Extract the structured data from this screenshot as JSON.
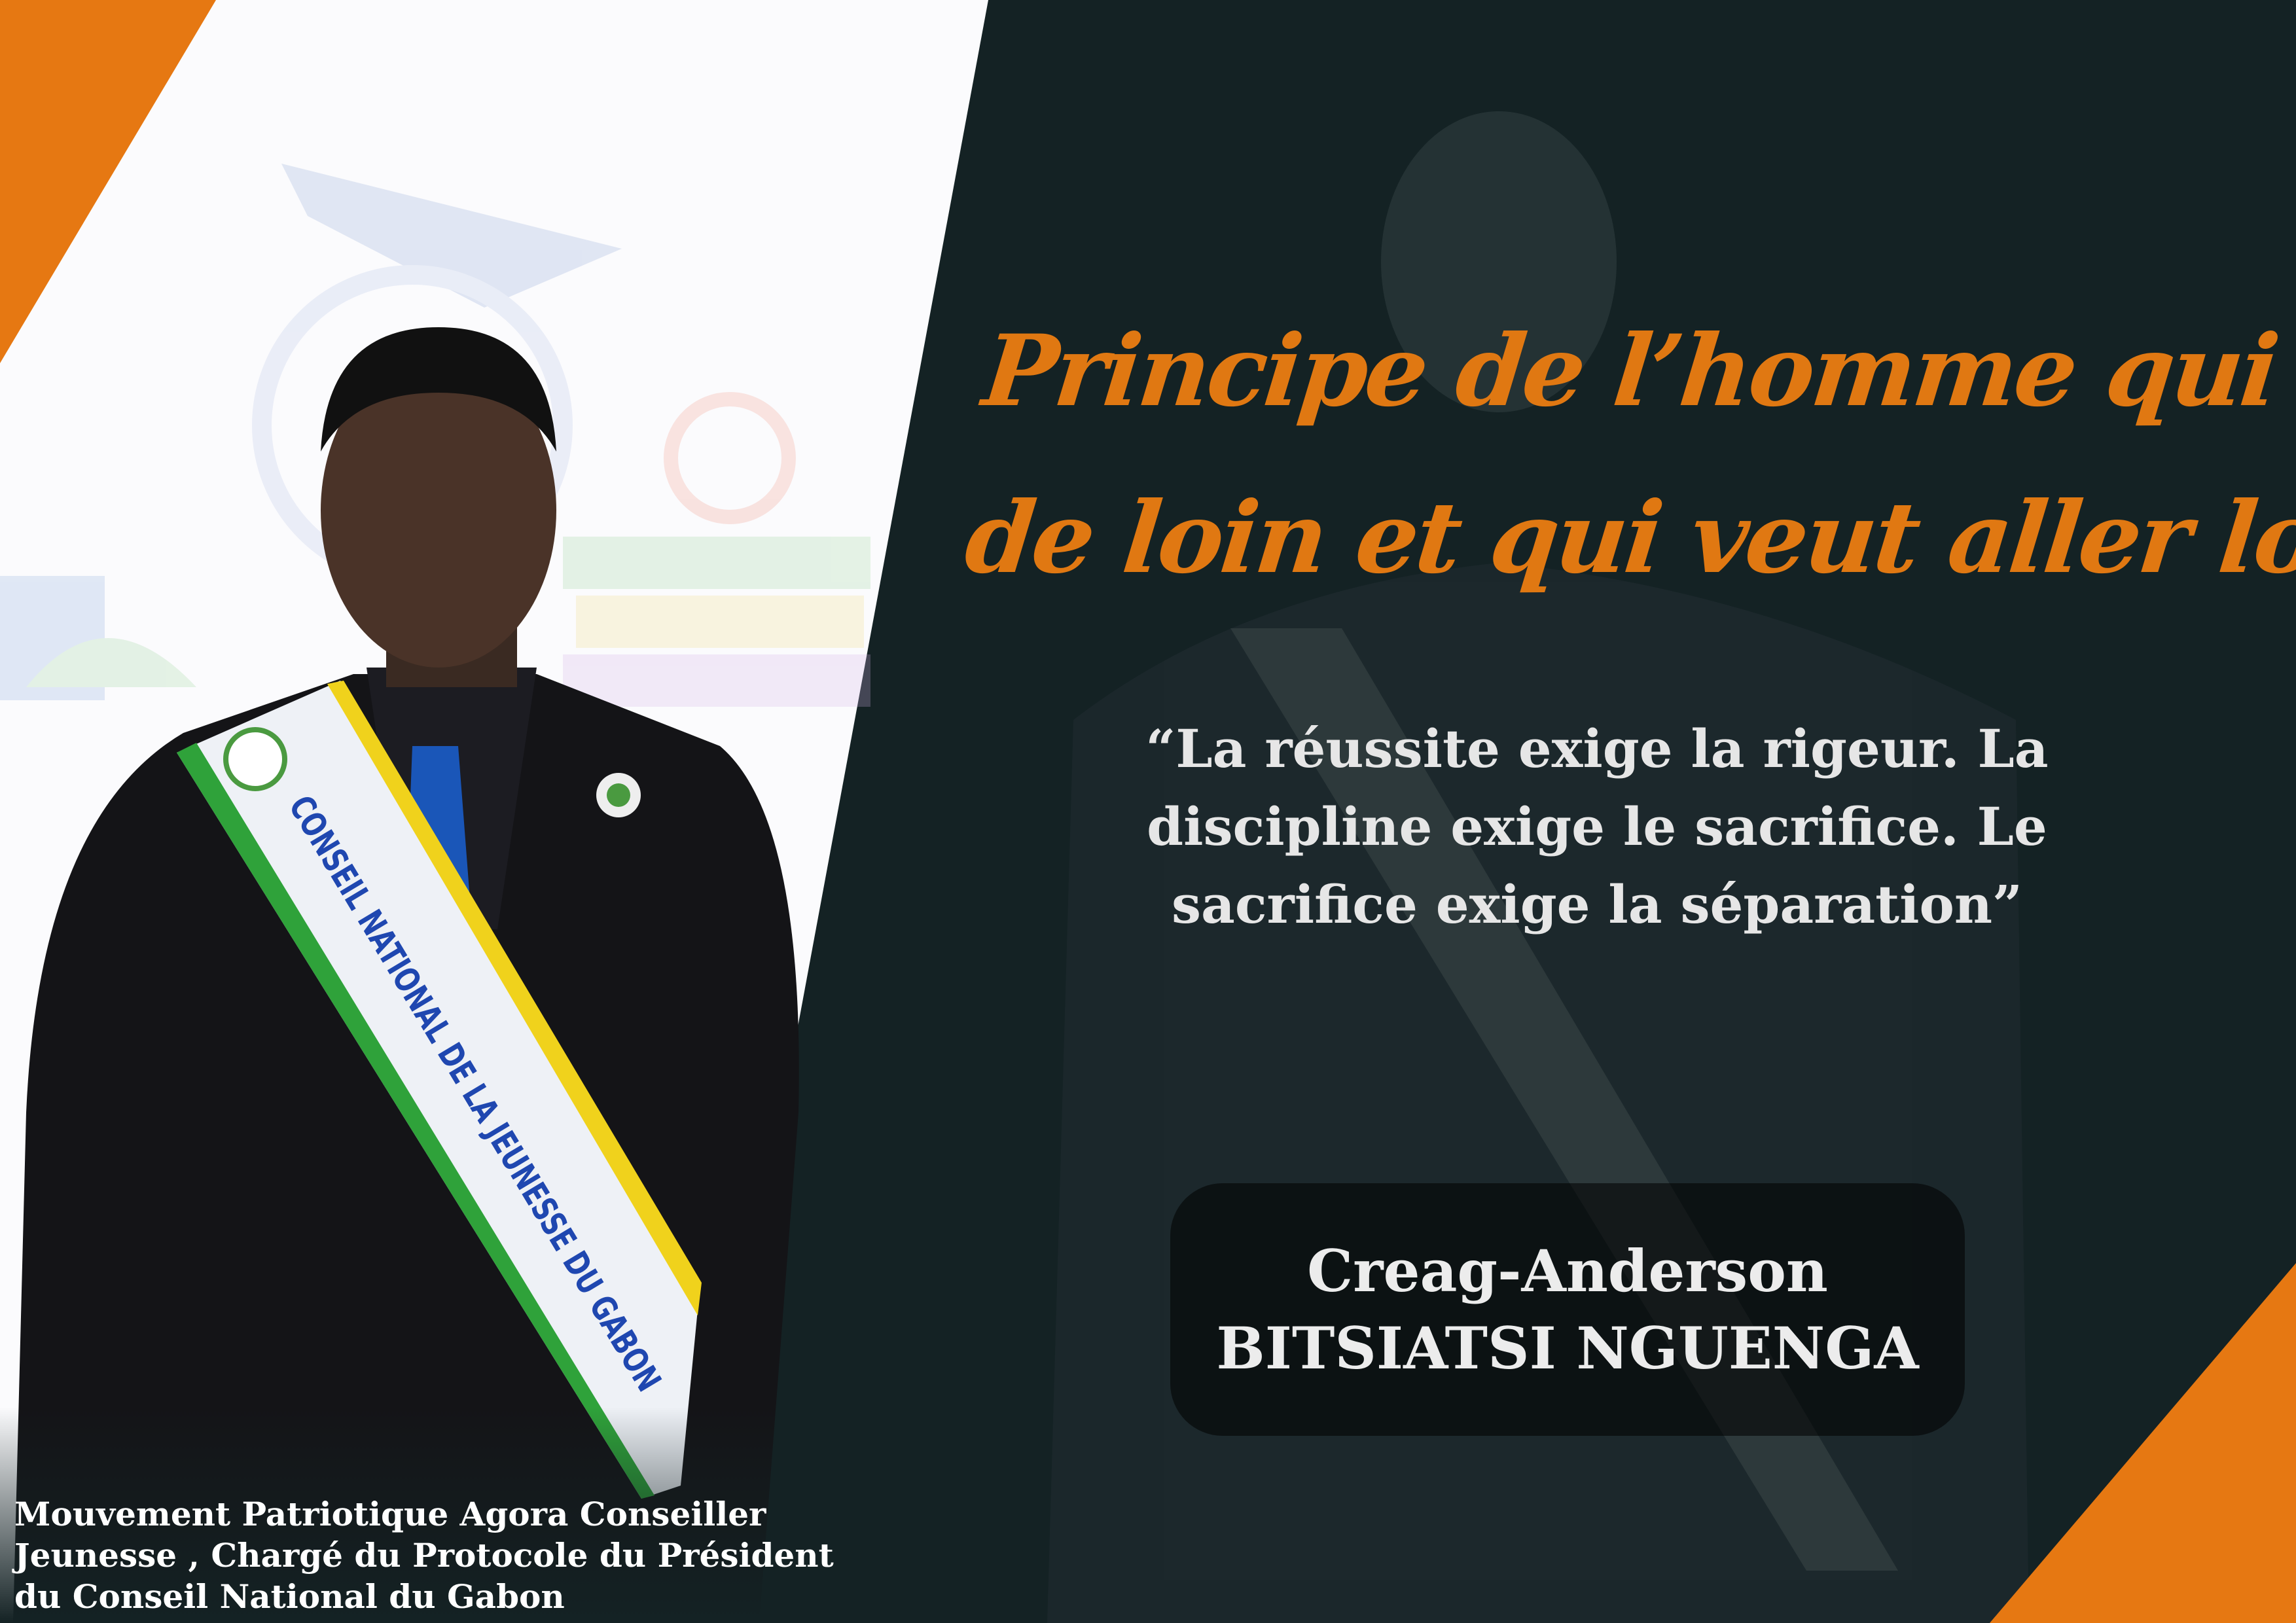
{
  "poster": {
    "title_lines": [
      "Principe de l’homme qui vient",
      "de loin et qui veut aller loin"
    ],
    "quote_lines": [
      "“La réussite exige la rigeur. La",
      "discipline exige le sacrifice. Le",
      "sacrifice exige la séparation”"
    ],
    "name": {
      "first": "Creag-Anderson",
      "last": "BITSIATSI NGUENGA"
    },
    "caption_lines": [
      "Mouvement Patriotique Agora Conseiller",
      "Jeunesse , Chargé du Protocole du Président",
      "du Conseil National du Gabon"
    ],
    "sash_text": "CONSEIL NATIONAL DE LA JEUNESSE DU GABON"
  },
  "colors": {
    "background": "#142224",
    "accent": "#e07812",
    "text": "#e6e6e6"
  }
}
